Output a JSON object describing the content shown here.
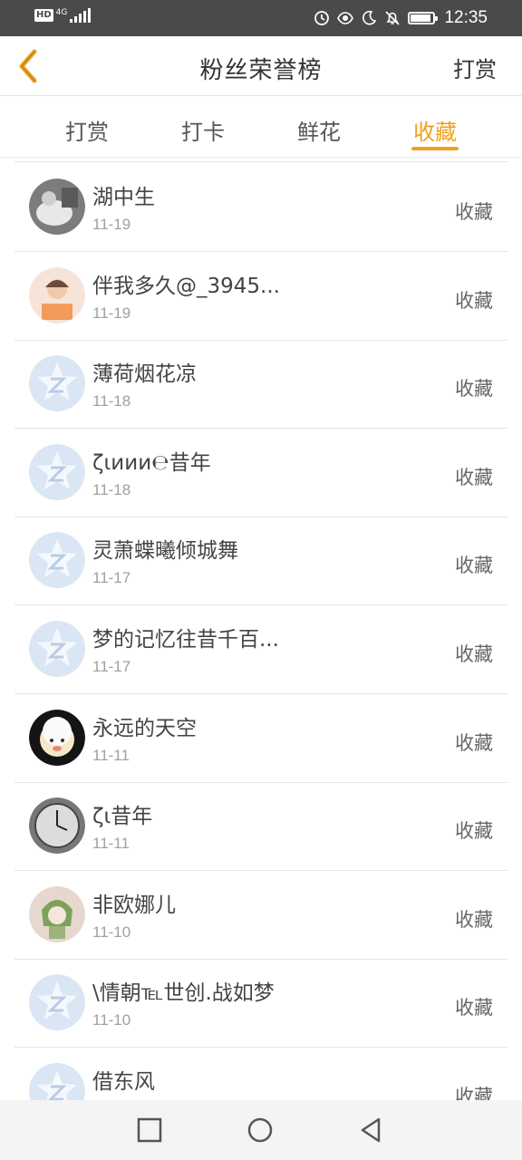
{
  "status_bar": {
    "hd": "HD",
    "network": "4G",
    "time": "12:35"
  },
  "nav": {
    "title": "粉丝荣誉榜",
    "action": "打赏"
  },
  "tabs": [
    {
      "label": "打赏"
    },
    {
      "label": "打卡"
    },
    {
      "label": "鲜花"
    },
    {
      "label": "收藏"
    }
  ],
  "active_tab": "收藏",
  "accent_color": "#f0a01e",
  "list": [
    {
      "name": "湖中生",
      "date": "11-19",
      "action": "收藏",
      "avatar": "photo-avatar-1"
    },
    {
      "name": "伴我多久@_3945...",
      "date": "11-19",
      "action": "收藏",
      "avatar": "photo-avatar-2"
    },
    {
      "name": "薄荷烟花凉",
      "date": "11-18",
      "action": "收藏",
      "avatar": "default-qq-avatar"
    },
    {
      "name": "ζιиии℮昔年",
      "date": "11-18",
      "action": "收藏",
      "avatar": "default-qq-avatar"
    },
    {
      "name": "灵萧蝶曦倾城舞",
      "date": "11-17",
      "action": "收藏",
      "avatar": "default-qq-avatar"
    },
    {
      "name": "梦的记忆往昔千百...",
      "date": "11-17",
      "action": "收藏",
      "avatar": "default-qq-avatar"
    },
    {
      "name": "永远的天空",
      "date": "11-11",
      "action": "收藏",
      "avatar": "cartoon-avatar"
    },
    {
      "name": "ζι昔年",
      "date": "11-11",
      "action": "收藏",
      "avatar": "clock-avatar"
    },
    {
      "name": "非欧娜儿",
      "date": "11-10",
      "action": "收藏",
      "avatar": "anime-avatar"
    },
    {
      "name": "\\情朝℡世创.战如梦",
      "date": "11-10",
      "action": "收藏",
      "avatar": "default-qq-avatar"
    },
    {
      "name": "借东风",
      "date": "",
      "action": "收藏",
      "avatar": "default-qq-avatar"
    }
  ]
}
